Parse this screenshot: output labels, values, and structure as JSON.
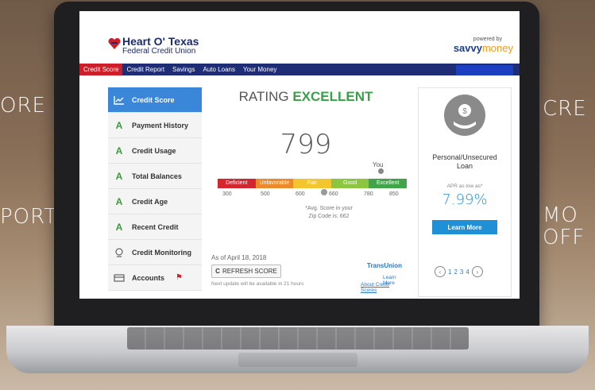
{
  "background_text": {
    "left_top": "ORE",
    "left_bottom": "PORT",
    "right_top": "CRE",
    "right_mid1": "MO",
    "right_mid2": "OFF"
  },
  "header": {
    "logo_line1": "Heart O' Texas",
    "logo_line2": "Federal Credit Union",
    "powered_by": "powered by",
    "savvy_a": "savvy",
    "savvy_b": "money"
  },
  "nav": {
    "items": [
      "Credit Score",
      "Credit Report",
      "Savings",
      "Auto Loans",
      "Your Money"
    ],
    "active_index": 0
  },
  "sidebar": {
    "items": [
      {
        "grade": "",
        "icon": "chart-icon",
        "label": "Credit Score"
      },
      {
        "grade": "A",
        "label": "Payment History"
      },
      {
        "grade": "A",
        "label": "Credit Usage"
      },
      {
        "grade": "A",
        "label": "Total Balances"
      },
      {
        "grade": "A",
        "label": "Credit Age"
      },
      {
        "grade": "A",
        "label": "Recent Credit"
      },
      {
        "grade": "",
        "icon": "monitor-icon",
        "label": "Credit Monitoring"
      },
      {
        "grade": "",
        "icon": "accounts-icon",
        "label": "Accounts"
      }
    ]
  },
  "main": {
    "rating_prefix": "RATING",
    "rating_value": "EXCELLENT",
    "score": "799",
    "you_label": "You",
    "bands": [
      {
        "label": "Deficient",
        "color": "#d3262e"
      },
      {
        "label": "Unfavorable",
        "color": "#ec8a2a"
      },
      {
        "label": "Fair",
        "color": "#f5c531"
      },
      {
        "label": "Good",
        "color": "#8cc63f"
      },
      {
        "label": "Excellent",
        "color": "#43a34a"
      }
    ],
    "ticks": [
      "300",
      "500",
      "600",
      "660",
      "780",
      "850"
    ],
    "avg_line1": "*Avg. Score in your",
    "avg_line2": "Zip Code is: 662",
    "as_of": "As of April 18, 2018",
    "refresh_label": "REFRESH SCORE",
    "next_update": "Next update will be available in 21 hours",
    "transunion": "TransUnion",
    "learn_more": "Learn More",
    "about_scores": "About Credit Scores"
  },
  "offer": {
    "title_line1": "Personal/Unsecured",
    "title_line2": "Loan",
    "apr_label": "APR as low as*",
    "rate": "7.99%",
    "button": "Learn More",
    "pages": [
      "1",
      "2",
      "3",
      "4"
    ]
  }
}
